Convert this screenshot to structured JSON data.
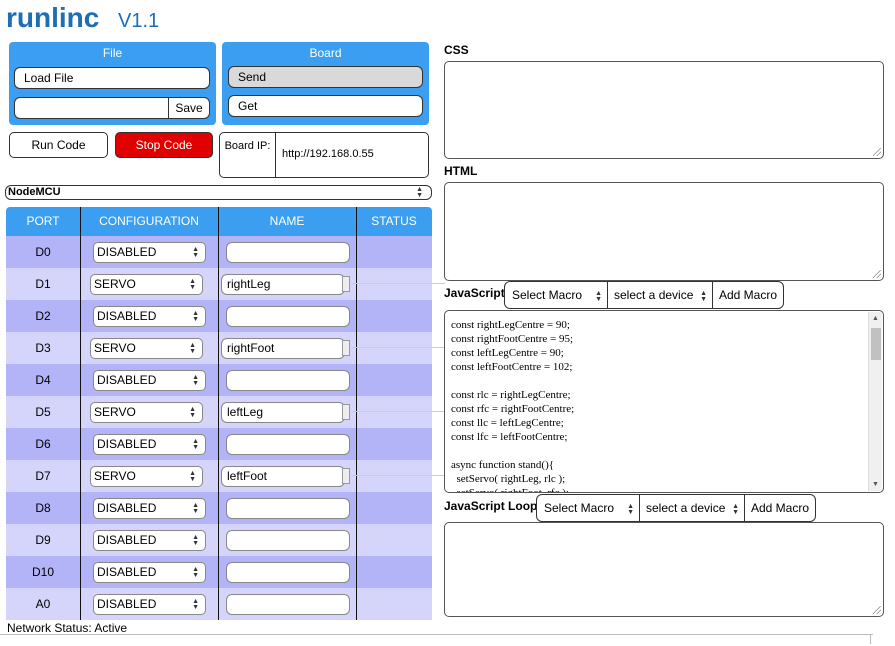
{
  "app": {
    "title": "runlinc",
    "version": "V1.1"
  },
  "file_panel": {
    "title": "File",
    "load_label": "Load File",
    "filename_value": "",
    "save_label": "Save"
  },
  "board_panel": {
    "title": "Board",
    "send_label": "Send",
    "get_label": "Get"
  },
  "controls": {
    "run_label": "Run Code",
    "stop_label": "Stop Code"
  },
  "board_ip": {
    "label": "Board IP:",
    "value": "http://192.168.0.55"
  },
  "board_type": {
    "selected": "NodeMCU"
  },
  "table": {
    "headers": [
      "PORT",
      "CONFIGURATION",
      "NAME",
      "STATUS"
    ],
    "rows": [
      {
        "port": "D0",
        "config": "DISABLED",
        "name": ""
      },
      {
        "port": "D1",
        "config": "SERVO",
        "name": "rightLeg"
      },
      {
        "port": "D2",
        "config": "DISABLED",
        "name": ""
      },
      {
        "port": "D3",
        "config": "SERVO",
        "name": "rightFoot"
      },
      {
        "port": "D4",
        "config": "DISABLED",
        "name": ""
      },
      {
        "port": "D5",
        "config": "SERVO",
        "name": "leftLeg"
      },
      {
        "port": "D6",
        "config": "DISABLED",
        "name": ""
      },
      {
        "port": "D7",
        "config": "SERVO",
        "name": "leftFoot"
      },
      {
        "port": "D8",
        "config": "DISABLED",
        "name": ""
      },
      {
        "port": "D9",
        "config": "DISABLED",
        "name": ""
      },
      {
        "port": "D10",
        "config": "DISABLED",
        "name": ""
      },
      {
        "port": "A0",
        "config": "DISABLED",
        "name": ""
      }
    ]
  },
  "status_bar": {
    "text": "Network Status: Active"
  },
  "editor": {
    "css_label": "CSS",
    "html_label": "HTML",
    "js_label": "JavaScript",
    "js_loop_label": "JavaScript Loop",
    "macro_select": "Select Macro",
    "device_select": "select a device",
    "add_macro_label": "Add Macro",
    "code_lines": [
      "const rightLegCentre = 90;",
      "const rightFootCentre = 95;",
      "const leftLegCentre = 90;",
      "const leftFootCentre = 102;",
      "",
      "const rlc = rightLegCentre;",
      "const rfc = rightFootCentre;",
      "const llc = leftLegCentre;",
      "const lfc = leftFootCentre;",
      "",
      "async function stand(){",
      "  setServo( rightLeg, rlc );",
      "  setServo( rightFoot, rfc );"
    ]
  },
  "colors": {
    "accent": "#3b9ef0",
    "title": "#1d6fb5",
    "stop": "#e00000",
    "row_odd": "#b3b3f7",
    "row_even": "#d5d5fb"
  }
}
